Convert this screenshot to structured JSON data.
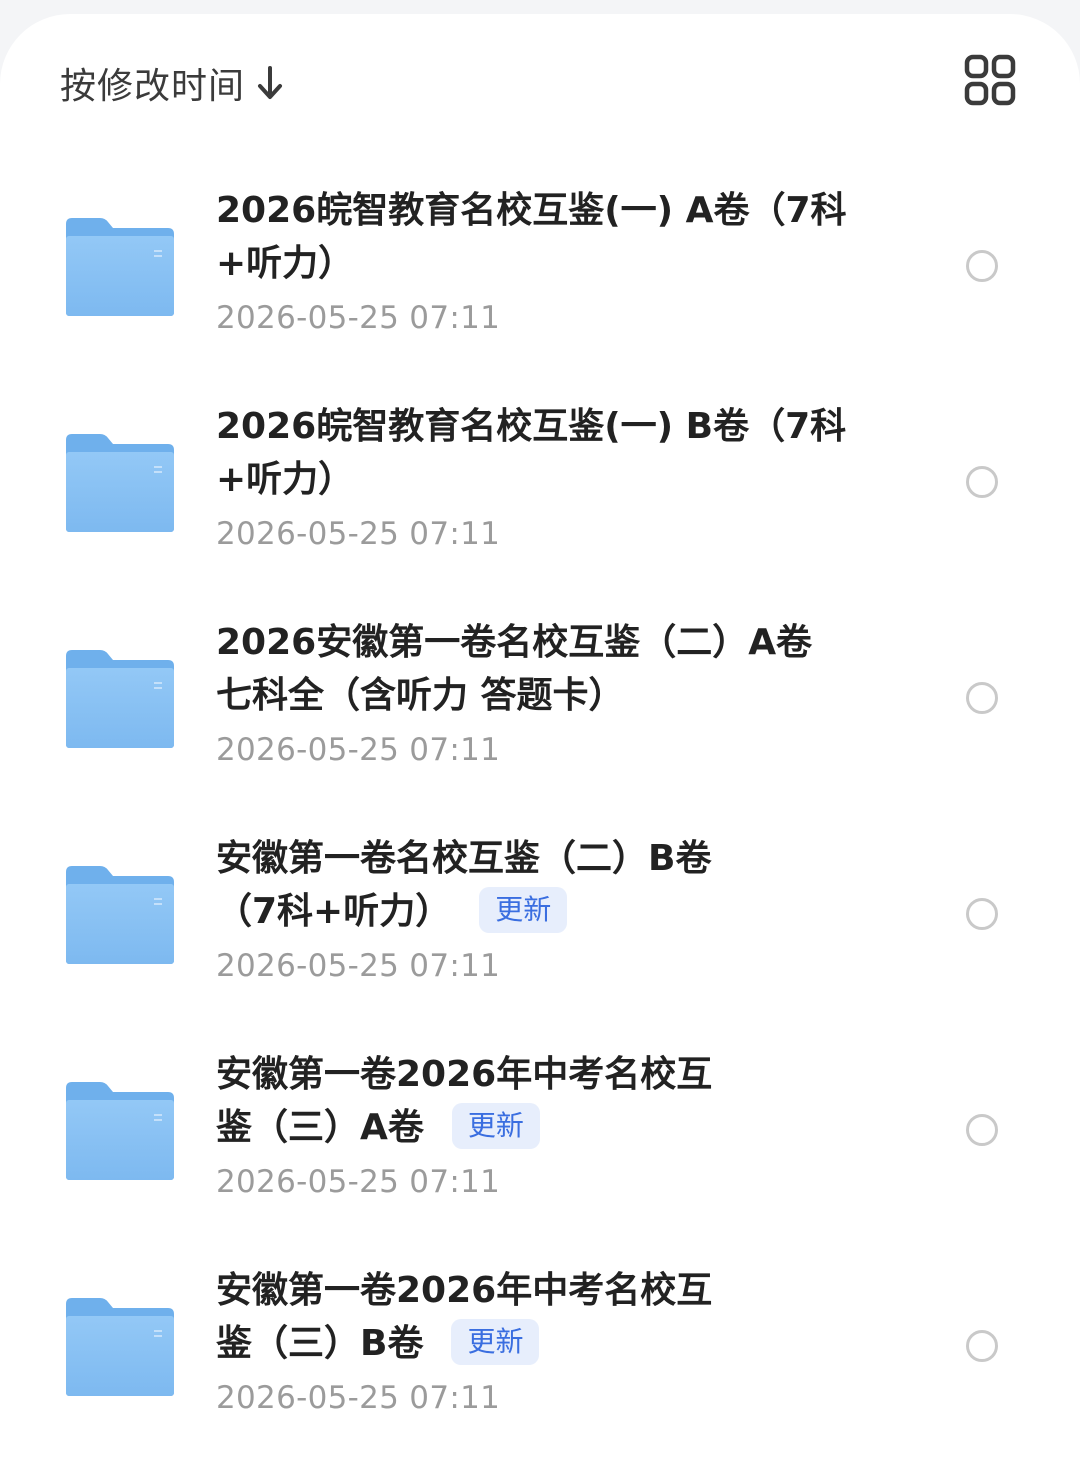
{
  "header": {
    "sort_label": "按修改时间",
    "sort_icon": "arrow-down-icon",
    "view_icon": "grid-view-icon"
  },
  "colors": {
    "folder": "#8cc3f4",
    "badge_bg": "#e7eefc",
    "badge_text": "#3a6ee0",
    "title_text": "#222222",
    "time_text": "#9b9b9b"
  },
  "files": [
    {
      "title_line1": "2026皖智教育名校互鉴(一) A卷（7科",
      "title_line2": "+听力）",
      "badge": "",
      "time": "2026-05-25 07:11"
    },
    {
      "title_line1": "2026皖智教育名校互鉴(一) B卷（7科",
      "title_line2": "+听力）",
      "badge": "",
      "time": "2026-05-25 07:11"
    },
    {
      "title_line1": "2026安徽第一卷名校互鉴（二）A卷",
      "title_line2": "七科全（含听力 答题卡）",
      "badge": "",
      "time": "2026-05-25 07:11"
    },
    {
      "title_line1": "安徽第一卷名校互鉴（二）B卷",
      "title_line2": "（7科+听力）",
      "badge": "更新",
      "time": "2026-05-25 07:11"
    },
    {
      "title_line1": "安徽第一卷2026年中考名校互",
      "title_line2": "鉴（三）A卷",
      "badge": "更新",
      "time": "2026-05-25 07:11"
    },
    {
      "title_line1": "安徽第一卷2026年中考名校互",
      "title_line2": "鉴（三）B卷",
      "badge": "更新",
      "time": "2026-05-25 07:11"
    }
  ]
}
